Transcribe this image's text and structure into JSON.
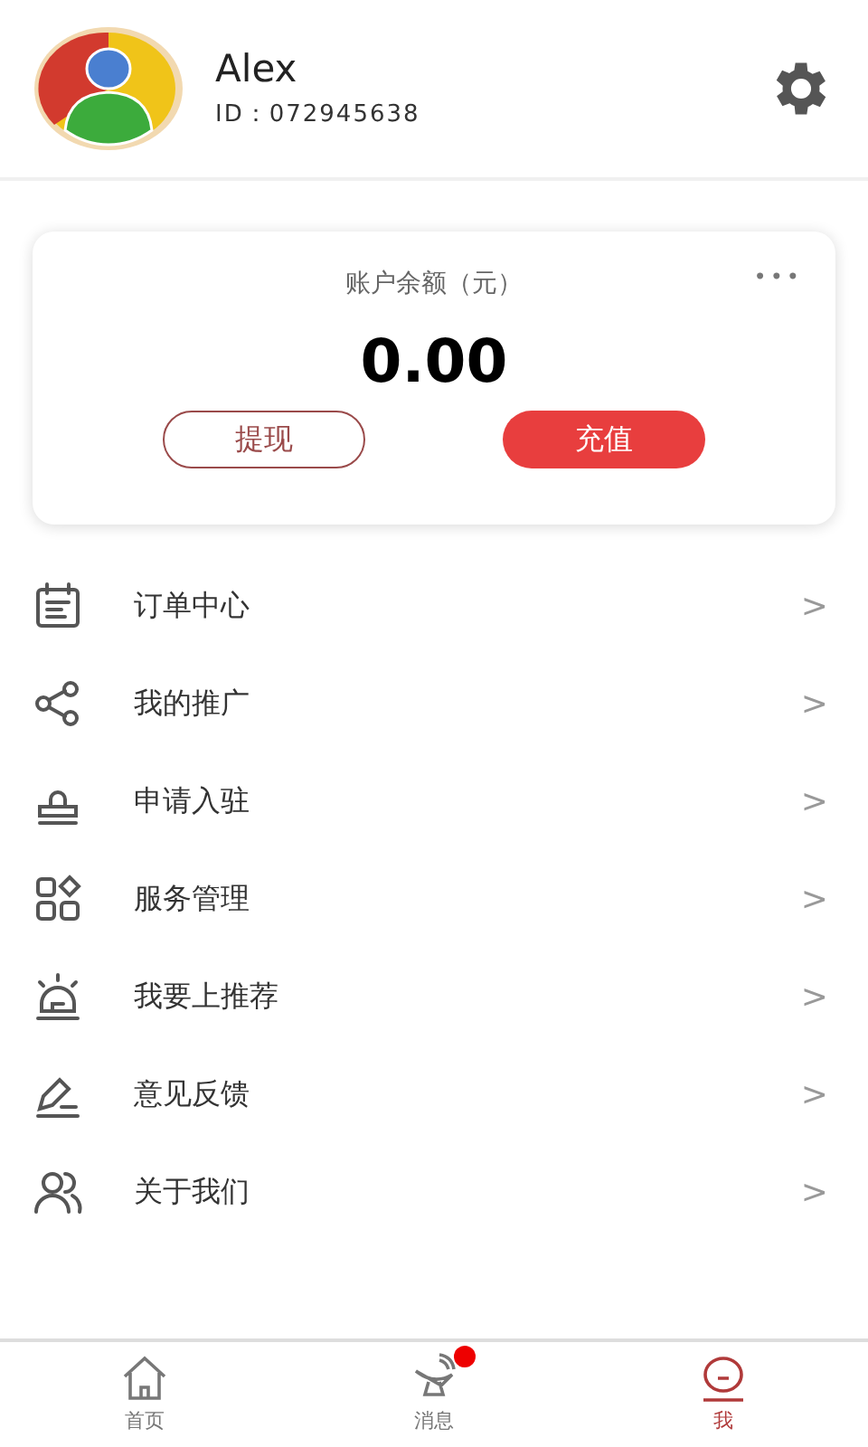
{
  "profile": {
    "name": "Alex",
    "id": "ID：072945638"
  },
  "balance": {
    "label": "账户余额（元）",
    "more": "•••",
    "amount": "0.00",
    "buttons": [
      {
        "kind": "outline",
        "label": "提现"
      },
      {
        "kind": "filled",
        "label": "充值"
      }
    ]
  },
  "menu": [
    {
      "kind": "calendar",
      "label": "订单中心",
      "arrow": ">"
    },
    {
      "kind": "share",
      "label": "我的推广",
      "arrow": ">"
    },
    {
      "kind": "stamp",
      "label": "申请入驻",
      "arrow": ">"
    },
    {
      "kind": "grid",
      "label": "服务管理",
      "arrow": ">"
    },
    {
      "kind": "alarm",
      "label": "我要上推荐",
      "arrow": ">"
    },
    {
      "kind": "pen",
      "label": "意见反馈",
      "arrow": ">"
    },
    {
      "kind": "people",
      "label": "关于我们",
      "arrow": ">"
    }
  ],
  "tabs": [
    {
      "kind": "home",
      "label": "首页",
      "selected": false,
      "dot": false
    },
    {
      "kind": "dish",
      "label": "消息",
      "selected": false,
      "dot": true
    },
    {
      "kind": "me",
      "label": "我",
      "selected": true,
      "dot": false
    }
  ]
}
